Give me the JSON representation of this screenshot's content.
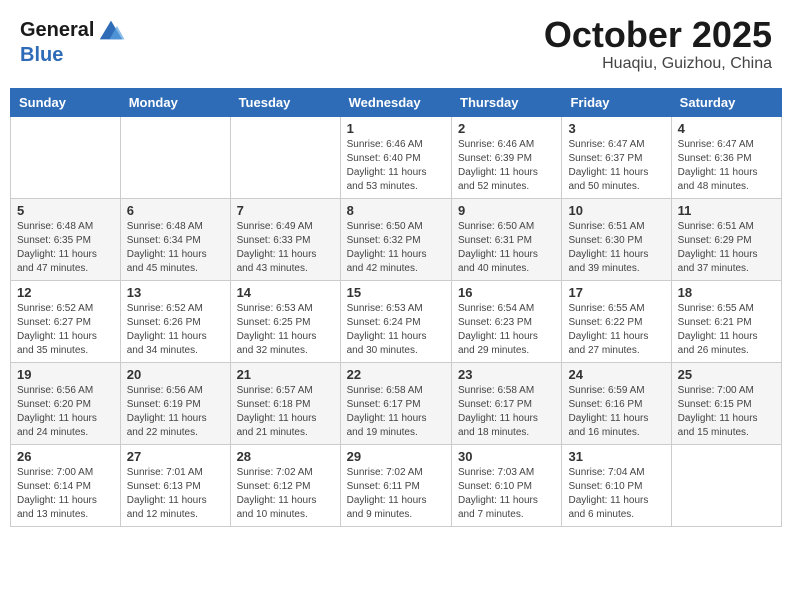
{
  "header": {
    "logo_line1": "General",
    "logo_line2": "Blue",
    "title": "October 2025",
    "subtitle": "Huaqiu, Guizhou, China"
  },
  "weekdays": [
    "Sunday",
    "Monday",
    "Tuesday",
    "Wednesday",
    "Thursday",
    "Friday",
    "Saturday"
  ],
  "weeks": [
    [
      {
        "day": "",
        "info": ""
      },
      {
        "day": "",
        "info": ""
      },
      {
        "day": "",
        "info": ""
      },
      {
        "day": "1",
        "info": "Sunrise: 6:46 AM\nSunset: 6:40 PM\nDaylight: 11 hours\nand 53 minutes."
      },
      {
        "day": "2",
        "info": "Sunrise: 6:46 AM\nSunset: 6:39 PM\nDaylight: 11 hours\nand 52 minutes."
      },
      {
        "day": "3",
        "info": "Sunrise: 6:47 AM\nSunset: 6:37 PM\nDaylight: 11 hours\nand 50 minutes."
      },
      {
        "day": "4",
        "info": "Sunrise: 6:47 AM\nSunset: 6:36 PM\nDaylight: 11 hours\nand 48 minutes."
      }
    ],
    [
      {
        "day": "5",
        "info": "Sunrise: 6:48 AM\nSunset: 6:35 PM\nDaylight: 11 hours\nand 47 minutes."
      },
      {
        "day": "6",
        "info": "Sunrise: 6:48 AM\nSunset: 6:34 PM\nDaylight: 11 hours\nand 45 minutes."
      },
      {
        "day": "7",
        "info": "Sunrise: 6:49 AM\nSunset: 6:33 PM\nDaylight: 11 hours\nand 43 minutes."
      },
      {
        "day": "8",
        "info": "Sunrise: 6:50 AM\nSunset: 6:32 PM\nDaylight: 11 hours\nand 42 minutes."
      },
      {
        "day": "9",
        "info": "Sunrise: 6:50 AM\nSunset: 6:31 PM\nDaylight: 11 hours\nand 40 minutes."
      },
      {
        "day": "10",
        "info": "Sunrise: 6:51 AM\nSunset: 6:30 PM\nDaylight: 11 hours\nand 39 minutes."
      },
      {
        "day": "11",
        "info": "Sunrise: 6:51 AM\nSunset: 6:29 PM\nDaylight: 11 hours\nand 37 minutes."
      }
    ],
    [
      {
        "day": "12",
        "info": "Sunrise: 6:52 AM\nSunset: 6:27 PM\nDaylight: 11 hours\nand 35 minutes."
      },
      {
        "day": "13",
        "info": "Sunrise: 6:52 AM\nSunset: 6:26 PM\nDaylight: 11 hours\nand 34 minutes."
      },
      {
        "day": "14",
        "info": "Sunrise: 6:53 AM\nSunset: 6:25 PM\nDaylight: 11 hours\nand 32 minutes."
      },
      {
        "day": "15",
        "info": "Sunrise: 6:53 AM\nSunset: 6:24 PM\nDaylight: 11 hours\nand 30 minutes."
      },
      {
        "day": "16",
        "info": "Sunrise: 6:54 AM\nSunset: 6:23 PM\nDaylight: 11 hours\nand 29 minutes."
      },
      {
        "day": "17",
        "info": "Sunrise: 6:55 AM\nSunset: 6:22 PM\nDaylight: 11 hours\nand 27 minutes."
      },
      {
        "day": "18",
        "info": "Sunrise: 6:55 AM\nSunset: 6:21 PM\nDaylight: 11 hours\nand 26 minutes."
      }
    ],
    [
      {
        "day": "19",
        "info": "Sunrise: 6:56 AM\nSunset: 6:20 PM\nDaylight: 11 hours\nand 24 minutes."
      },
      {
        "day": "20",
        "info": "Sunrise: 6:56 AM\nSunset: 6:19 PM\nDaylight: 11 hours\nand 22 minutes."
      },
      {
        "day": "21",
        "info": "Sunrise: 6:57 AM\nSunset: 6:18 PM\nDaylight: 11 hours\nand 21 minutes."
      },
      {
        "day": "22",
        "info": "Sunrise: 6:58 AM\nSunset: 6:17 PM\nDaylight: 11 hours\nand 19 minutes."
      },
      {
        "day": "23",
        "info": "Sunrise: 6:58 AM\nSunset: 6:17 PM\nDaylight: 11 hours\nand 18 minutes."
      },
      {
        "day": "24",
        "info": "Sunrise: 6:59 AM\nSunset: 6:16 PM\nDaylight: 11 hours\nand 16 minutes."
      },
      {
        "day": "25",
        "info": "Sunrise: 7:00 AM\nSunset: 6:15 PM\nDaylight: 11 hours\nand 15 minutes."
      }
    ],
    [
      {
        "day": "26",
        "info": "Sunrise: 7:00 AM\nSunset: 6:14 PM\nDaylight: 11 hours\nand 13 minutes."
      },
      {
        "day": "27",
        "info": "Sunrise: 7:01 AM\nSunset: 6:13 PM\nDaylight: 11 hours\nand 12 minutes."
      },
      {
        "day": "28",
        "info": "Sunrise: 7:02 AM\nSunset: 6:12 PM\nDaylight: 11 hours\nand 10 minutes."
      },
      {
        "day": "29",
        "info": "Sunrise: 7:02 AM\nSunset: 6:11 PM\nDaylight: 11 hours\nand 9 minutes."
      },
      {
        "day": "30",
        "info": "Sunrise: 7:03 AM\nSunset: 6:10 PM\nDaylight: 11 hours\nand 7 minutes."
      },
      {
        "day": "31",
        "info": "Sunrise: 7:04 AM\nSunset: 6:10 PM\nDaylight: 11 hours\nand 6 minutes."
      },
      {
        "day": "",
        "info": ""
      }
    ]
  ]
}
